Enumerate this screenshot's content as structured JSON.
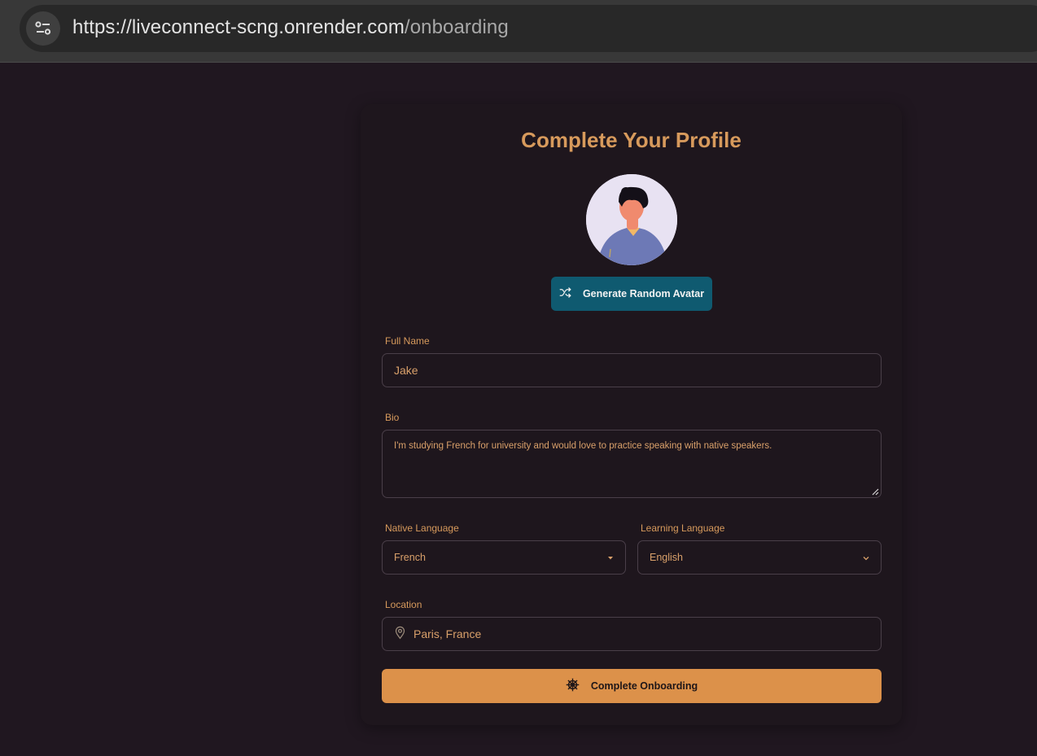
{
  "browser": {
    "url_host": "https://liveconnect-scng.onrender.com",
    "url_path": "/onboarding",
    "settings_icon": "tune-icon"
  },
  "form": {
    "title": "Complete Your Profile",
    "avatar_button_label": "Generate Random Avatar",
    "avatar_button_icon": "shuffle-icon",
    "full_name": {
      "label": "Full Name",
      "value": "Jake"
    },
    "bio": {
      "label": "Bio",
      "value": "I'm studying French for university and would love to practice speaking with native speakers."
    },
    "native_language": {
      "label": "Native Language",
      "value": "French"
    },
    "learning_language": {
      "label": "Learning Language",
      "value": "English"
    },
    "location": {
      "label": "Location",
      "value": "Paris, France",
      "icon": "map-pin-icon"
    },
    "submit_label": "Complete Onboarding",
    "submit_icon": "ship-wheel-icon"
  },
  "colors": {
    "page_bg": "#201720",
    "accent": "#d79a5c",
    "primary_button": "#dc914a",
    "secondary_button": "#0f5a70"
  }
}
